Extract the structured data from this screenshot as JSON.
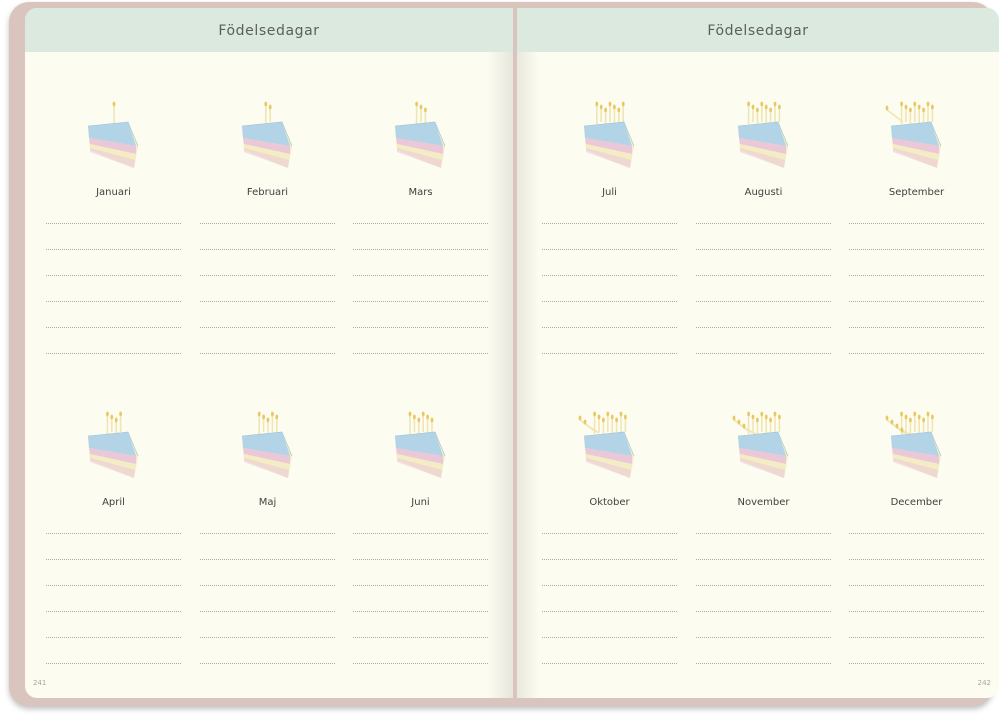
{
  "left_page": {
    "header": "Födelsedagar",
    "page_number": "241",
    "months": [
      {
        "name": "Januari",
        "candles": 1
      },
      {
        "name": "Februari",
        "candles": 2
      },
      {
        "name": "Mars",
        "candles": 3
      },
      {
        "name": "April",
        "candles": 4
      },
      {
        "name": "Maj",
        "candles": 5
      },
      {
        "name": "Juni",
        "candles": 6
      }
    ]
  },
  "right_page": {
    "header": "Födelsedagar",
    "page_number": "242",
    "months": [
      {
        "name": "Juli",
        "candles": 7
      },
      {
        "name": "Augusti",
        "candles": 8
      },
      {
        "name": "September",
        "candles": 9
      },
      {
        "name": "Oktober",
        "candles": 10
      },
      {
        "name": "November",
        "candles": 11
      },
      {
        "name": "December",
        "candles": 12
      }
    ]
  },
  "colors": {
    "header_band": "#dbe9de",
    "paper": "#fcfcf1",
    "cover": "#d9c5bd",
    "cake_blue": "#b3d3e6",
    "cake_pink": "#ebc8d8",
    "cake_cream": "#f3ecc4",
    "candle_flame": "#e9c863"
  },
  "icon": "birthday-cake-slice-icon"
}
